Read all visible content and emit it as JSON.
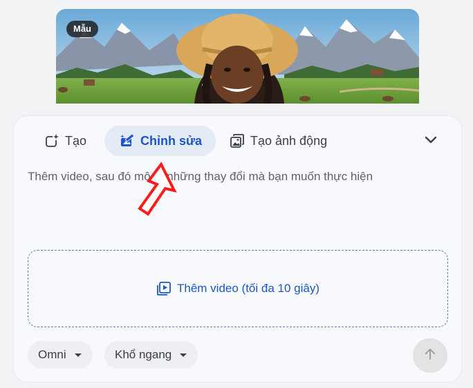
{
  "preview": {
    "badge": "Mẫu"
  },
  "tabs": [
    {
      "label": "Tạo",
      "icon": "sparkle-square-icon",
      "selected": false
    },
    {
      "label": "Chỉnh sửa",
      "icon": "magic-edit-icon",
      "selected": true
    },
    {
      "label": "Tạo ảnh động",
      "icon": "image-stack-sparkle-icon",
      "selected": false
    }
  ],
  "prompt": {
    "placeholder": "Thêm video, sau đó mô tả những thay đổi mà bạn muốn thực hiện"
  },
  "dropzone": {
    "label": "Thêm video (tối đa 10 giây)",
    "icon": "video-library-icon"
  },
  "chips": [
    {
      "label": "Omni"
    },
    {
      "label": "Khổ ngang"
    }
  ],
  "colors": {
    "accent": "#1a56c8",
    "selected_tab_bg": "#e4eaf6",
    "annotation_arrow": "#ff1a1a"
  }
}
